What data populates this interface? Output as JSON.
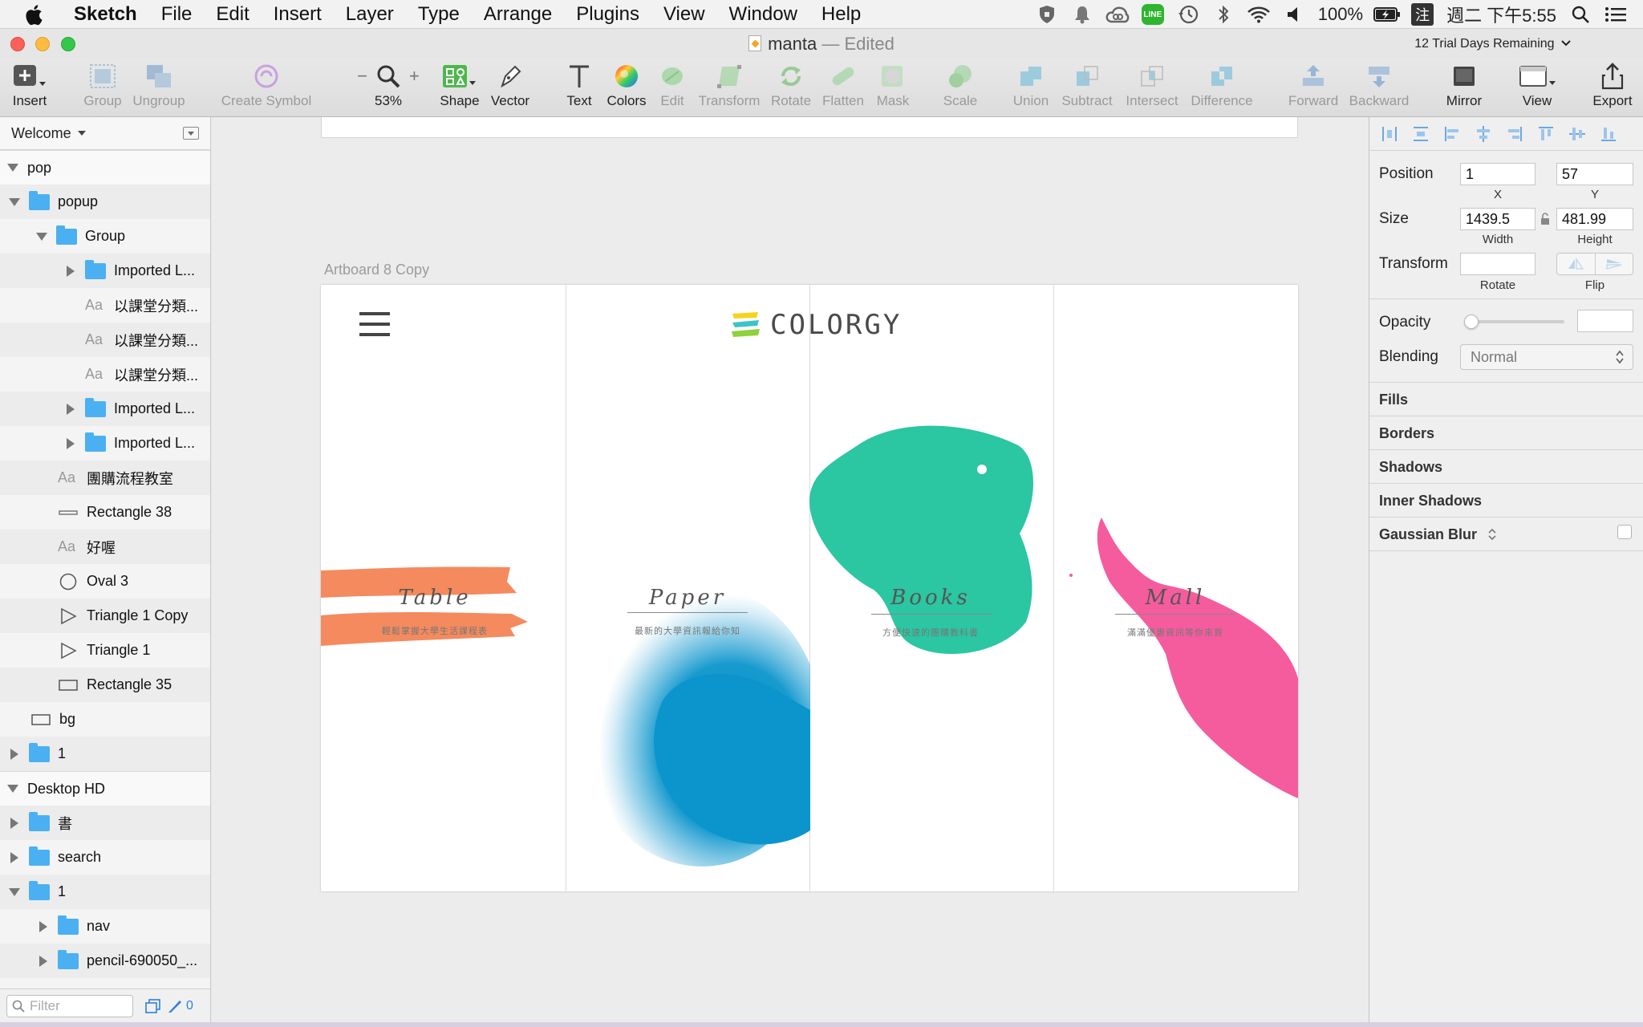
{
  "menubar": {
    "app_name": "Sketch",
    "items": [
      "File",
      "Edit",
      "Insert",
      "Layer",
      "Type",
      "Arrange",
      "Plugins",
      "View",
      "Window",
      "Help"
    ],
    "line_badge": "LINE",
    "battery": "100%",
    "ime": "注",
    "clock": "週二 下午5:55"
  },
  "window": {
    "doc_name": "manta",
    "doc_separator": "—",
    "doc_status": "Edited",
    "trial_notice": "12 Trial Days Remaining"
  },
  "toolbar": {
    "insert": "Insert",
    "group": "Group",
    "ungroup": "Ungroup",
    "create_symbol": "Create Symbol",
    "zoom_minus": "−",
    "zoom_plus": "+",
    "zoom_value": "53%",
    "shape": "Shape",
    "vector": "Vector",
    "text": "Text",
    "colors": "Colors",
    "edit": "Edit",
    "transform": "Transform",
    "rotate": "Rotate",
    "flatten": "Flatten",
    "mask": "Mask",
    "scale": "Scale",
    "union": "Union",
    "subtract": "Subtract",
    "intersect": "Intersect",
    "difference": "Difference",
    "forward": "Forward",
    "backward": "Backward",
    "mirror": "Mirror",
    "view": "View",
    "export": "Export"
  },
  "layers": {
    "page_selector": "Welcome",
    "rows": [
      {
        "label": "pop"
      },
      {
        "label": "popup"
      },
      {
        "label": "Group"
      },
      {
        "label": "Imported L..."
      },
      {
        "label": "以課堂分類..."
      },
      {
        "label": "以課堂分類..."
      },
      {
        "label": "以課堂分類..."
      },
      {
        "label": "Imported L..."
      },
      {
        "label": "Imported L..."
      },
      {
        "label": "團購流程教室"
      },
      {
        "label": "Rectangle 38"
      },
      {
        "label": "好喔"
      },
      {
        "label": "Oval 3"
      },
      {
        "label": "Triangle 1 Copy"
      },
      {
        "label": "Triangle 1"
      },
      {
        "label": "Rectangle 35"
      },
      {
        "label": "bg"
      },
      {
        "label": "1"
      },
      {
        "label": "Desktop HD"
      },
      {
        "label": "書"
      },
      {
        "label": "search"
      },
      {
        "label": "1"
      },
      {
        "label": "nav"
      },
      {
        "label": "pencil-690050_..."
      }
    ],
    "text_icon": "Aa",
    "filter_placeholder": "Filter",
    "filter_count": "0"
  },
  "canvas": {
    "artboard_label": "Artboard 8 Copy",
    "brand": "COLORGY",
    "categories": [
      {
        "title": "Table",
        "subtitle": "輕鬆掌握大學生活課程表"
      },
      {
        "title": "Paper",
        "subtitle": "最新的大學資訊報給你知"
      },
      {
        "title": "Books",
        "subtitle": "方便快速的團購教科書"
      },
      {
        "title": "Mall",
        "subtitle": "滿滿優惠資訊等你來買"
      }
    ]
  },
  "inspector": {
    "position_label": "Position",
    "x": "1",
    "y": "57",
    "x_caption": "X",
    "y_caption": "Y",
    "size_label": "Size",
    "width": "1439.5",
    "height": "481.99",
    "width_caption": "Width",
    "height_caption": "Height",
    "transform_label": "Transform",
    "rotate_caption": "Rotate",
    "flip_caption": "Flip",
    "opacity_label": "Opacity",
    "opacity_value": 0,
    "blending_label": "Blending",
    "blending_value": "Normal",
    "sections": [
      "Fills",
      "Borders",
      "Shadows",
      "Inner Shadows",
      "Gaussian Blur"
    ]
  },
  "colors": {
    "table": "#f48a5e",
    "paper": "#0b95cc",
    "books": "#2bc6a2",
    "mall": "#f55c9e",
    "folder": "#4ab0f2"
  }
}
